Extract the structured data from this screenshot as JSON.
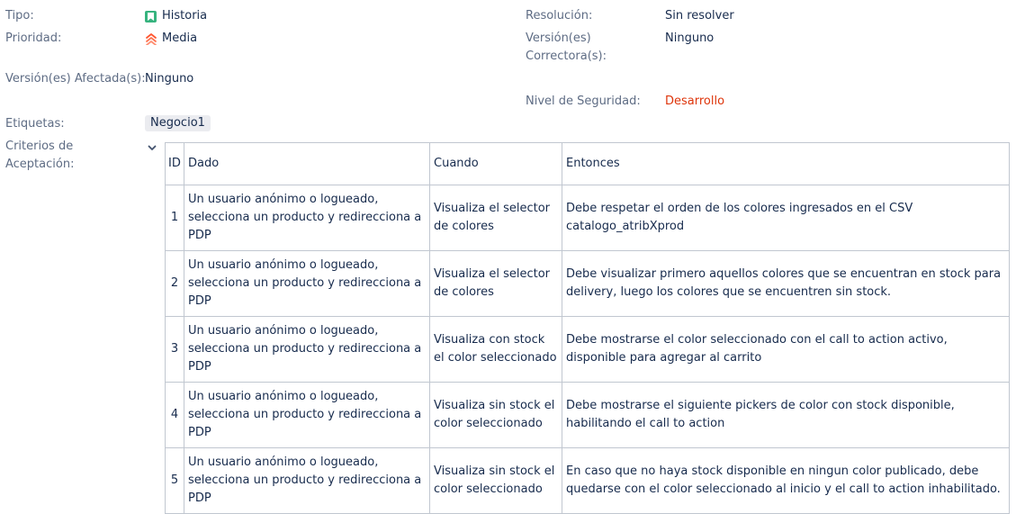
{
  "fields": {
    "tipo": {
      "label": "Tipo:",
      "value": "Historia"
    },
    "prioridad": {
      "label": "Prioridad:",
      "value": "Media"
    },
    "version_afectada": {
      "label": "Versión(es) Afectada(s):",
      "value": "Ninguno"
    },
    "etiquetas": {
      "label": "Etiquetas:",
      "value": "Negocio1"
    },
    "criterios": {
      "label_line1": "Criterios de",
      "label_line2": "Aceptación:"
    },
    "resolucion": {
      "label": "Resolución:",
      "value": "Sin resolver"
    },
    "version_correctora": {
      "label_line1": "Versión(es)",
      "label_line2": "Correctora(s):",
      "value": "Ninguno"
    },
    "nivel_seguridad": {
      "label": "Nivel de Seguridad:",
      "value": "Desarrollo"
    }
  },
  "colors": {
    "story": "#36b37e",
    "priority": "#ff5630",
    "security": "#de350b"
  },
  "icons": {
    "tipo": "story-icon",
    "prioridad": "priority-medium-icon",
    "criterios": "chevron-down-icon"
  },
  "table": {
    "headers": {
      "id": "ID",
      "dado": "Dado",
      "cuando": "Cuando",
      "entonces": "Entonces"
    },
    "rows": [
      {
        "id": "1",
        "dado": "Un usuario anónimo o logueado, selecciona un producto y redirecciona a PDP",
        "cuando": "Visualiza el selector de colores",
        "entonces": "Debe respetar el orden de los colores ingresados en el CSV catalogo_atribXprod"
      },
      {
        "id": "2",
        "dado": "Un usuario anónimo o logueado, selecciona un producto y redirecciona a PDP",
        "cuando": "Visualiza el selector de colores",
        "entonces": "Debe visualizar primero aquellos colores que se encuentran en stock para delivery, luego los colores que se encuentren sin stock."
      },
      {
        "id": "3",
        "dado": "Un usuario anónimo o logueado, selecciona un producto y redirecciona a PDP",
        "cuando": "Visualiza con stock el color seleccionado",
        "entonces": "Debe mostrarse el color seleccionado con el call to action activo, disponible para agregar al carrito"
      },
      {
        "id": "4",
        "dado": "Un usuario anónimo o logueado, selecciona un producto y redirecciona a PDP",
        "cuando": "Visualiza sin stock el color seleccionado",
        "entonces": "Debe mostrarse el siguiente pickers de color con stock disponible, habilitando el call to action"
      },
      {
        "id": "5",
        "dado": "Un usuario anónimo o logueado, selecciona un producto y redirecciona a PDP",
        "cuando": "Visualiza sin stock el color seleccionado",
        "entonces": "En caso que no haya stock disponible en ningun color publicado, debe quedarse con el color seleccionado al inicio y el call to action inhabilitado."
      }
    ]
  }
}
